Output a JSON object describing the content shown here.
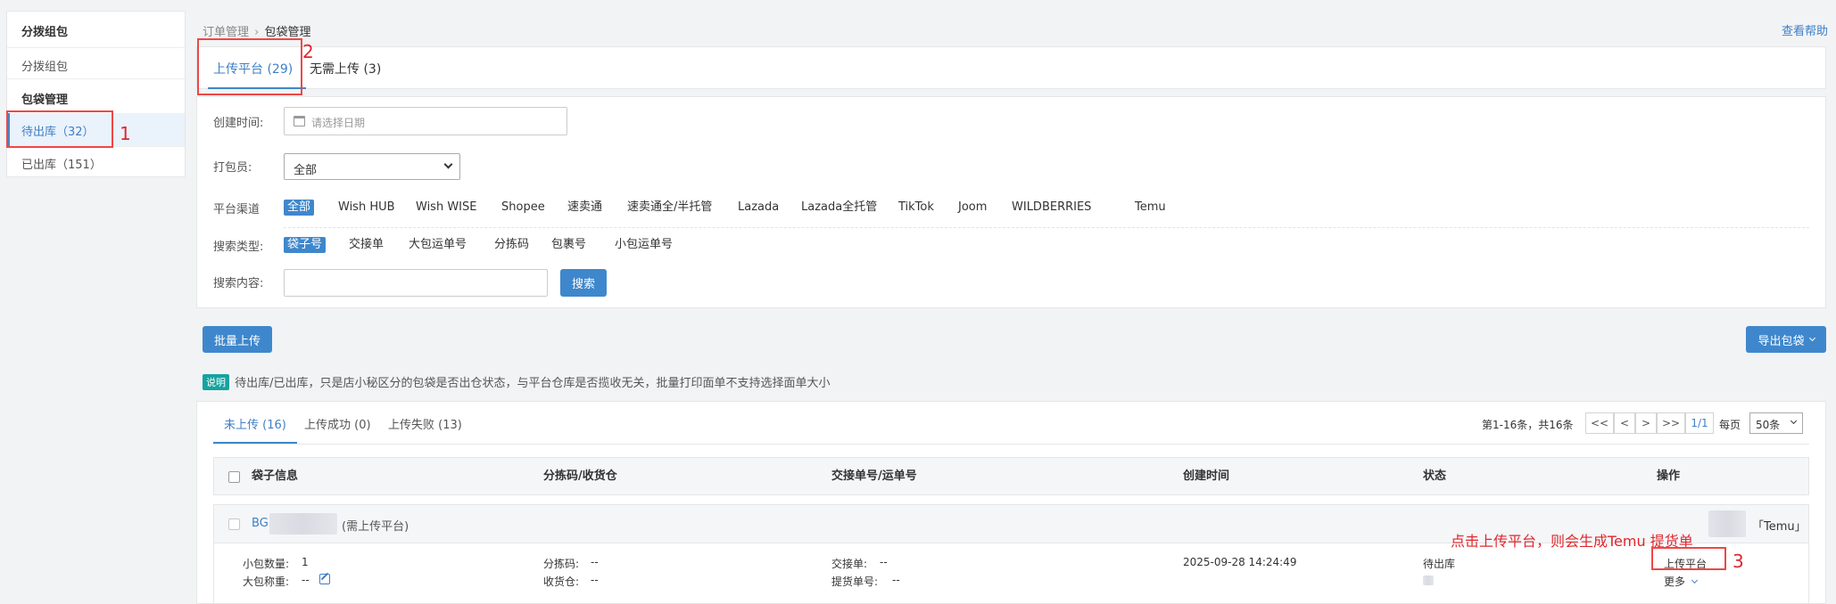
{
  "sidebar": {
    "groups": [
      {
        "title": "分拨组包",
        "items": [
          {
            "label": "分拨组包"
          }
        ]
      },
      {
        "title": "包袋管理",
        "items": [
          {
            "label": "待出库（32）"
          },
          {
            "label": "已出库（151）"
          }
        ]
      }
    ]
  },
  "breadcrumb": {
    "parent": "订单管理",
    "separator": "›",
    "current": "包袋管理"
  },
  "help_link": "查看帮助",
  "top_tabs": [
    {
      "label": "上传平台 (29)"
    },
    {
      "label": "无需上传 (3)"
    }
  ],
  "filters": {
    "created_time_label": "创建时间:",
    "date_placeholder": "请选择日期",
    "packer_label": "打包员:",
    "packer_selected": "全部",
    "channel_label": "平台渠道",
    "channels": [
      "全部",
      "Wish HUB",
      "Wish WISE",
      "Shopee",
      "速卖通",
      "速卖通全/半托管",
      "Lazada",
      "Lazada全托管",
      "TikTok",
      "Joom",
      "WILDBERRIES",
      "Temu"
    ],
    "search_type_label": "搜索类型:",
    "search_types": [
      "袋子号",
      "交接单",
      "大包运单号",
      "分拣码",
      "包裹号",
      "小包运单号"
    ],
    "search_content_label": "搜索内容:",
    "search_button": "搜索"
  },
  "toolbar": {
    "batch_upload": "批量上传",
    "export": "导出包袋"
  },
  "note": {
    "badge": "说明",
    "text": "待出库/已出库，只是店小秘区分的包袋是否出仓状态，与平台仓库是否揽收无关，批量打印面单不支持选择面单大小"
  },
  "sub_tabs": [
    {
      "label": "未上传 (16)"
    },
    {
      "label": "上传成功 (0)"
    },
    {
      "label": "上传失败 (13)"
    }
  ],
  "pager": {
    "summary": "第1-16条，共16条",
    "first": "<<",
    "prev": "<",
    "next": ">",
    "last": ">>",
    "page": "1/1",
    "per_page_label": "每页",
    "per_page_value": "50条"
  },
  "table": {
    "headers": [
      "袋子信息",
      "分拣码/收货仓",
      "交接单号/运单号",
      "创建时间",
      "状态",
      "操作"
    ],
    "group": {
      "bag_prefix": "BG",
      "tag": "(需上传平台)",
      "platform": "「Temu」"
    },
    "row": {
      "pkg_count_label": "小包数量:",
      "pkg_count_value": "1",
      "weight_label": "大包称重:",
      "weight_value": "--",
      "sort_code_label": "分拣码:",
      "sort_code_value": "--",
      "warehouse_label": "收货仓:",
      "warehouse_value": "--",
      "handover_label": "交接单:",
      "handover_value": "--",
      "pickup_label": "提货单号:",
      "pickup_value": "--",
      "created_time": "2025-09-28 14:24:49",
      "status": "待出库",
      "action_upload": "上传平台",
      "action_more": "更多"
    }
  },
  "annotations": {
    "num1": "1",
    "num2": "2",
    "num3": "3",
    "hint": "点击上传平台，则会生成Temu 提货单"
  }
}
